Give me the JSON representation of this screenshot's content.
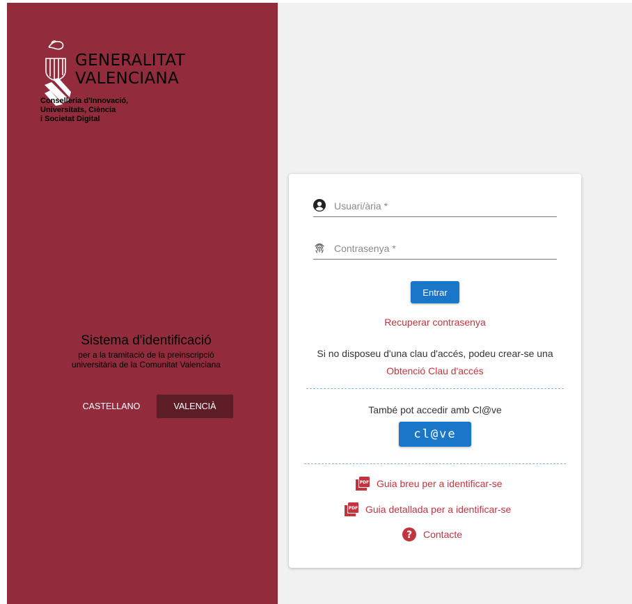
{
  "brand": {
    "name_line1": "GENERALITAT",
    "name_line2": "VALENCIANA",
    "dept_line1": "Conselleria d'Innovació,",
    "dept_line2": "Universitats, Ciència",
    "dept_line3": "i Societat Digital"
  },
  "system": {
    "title": "Sistema d'identificació",
    "subtitle_line1": "per a la tramitació de la preinscripció",
    "subtitle_line2": "universitària de la Comunitat Valenciana"
  },
  "languages": {
    "options": [
      "CASTELLANO",
      "VALENCIÀ"
    ],
    "selected": "VALENCIÀ"
  },
  "login": {
    "user_placeholder": "Usuari/ària *",
    "user_value": "",
    "password_placeholder": "Contrasenya *",
    "password_value": "",
    "submit_label": "Entrar",
    "recover_label": "Recuperar contrasenya",
    "no_key_text": "Si no disposeu d'una clau d'accés, podeu crear-se una",
    "obtain_key_label": "Obtenció Clau d'accés",
    "clave_text": "També pot accedir amb Cl@ve",
    "clave_button_label": "cl@ve"
  },
  "resources": {
    "guide_short": "Guia breu per a identificar-se",
    "guide_detailed": "Guia detallada per a identificar-se",
    "contact": "Contacte"
  },
  "icons": {
    "user": "user-circle-icon",
    "password": "fingerprint-icon",
    "pdf": "pdf-file-icon",
    "help": "question-circle-icon"
  },
  "colors": {
    "brand_panel": "#922c3c",
    "selected_language": "#5e1d26",
    "primary_button": "#1976c8",
    "link": "#c3343f",
    "background": "#f1f1f1"
  }
}
